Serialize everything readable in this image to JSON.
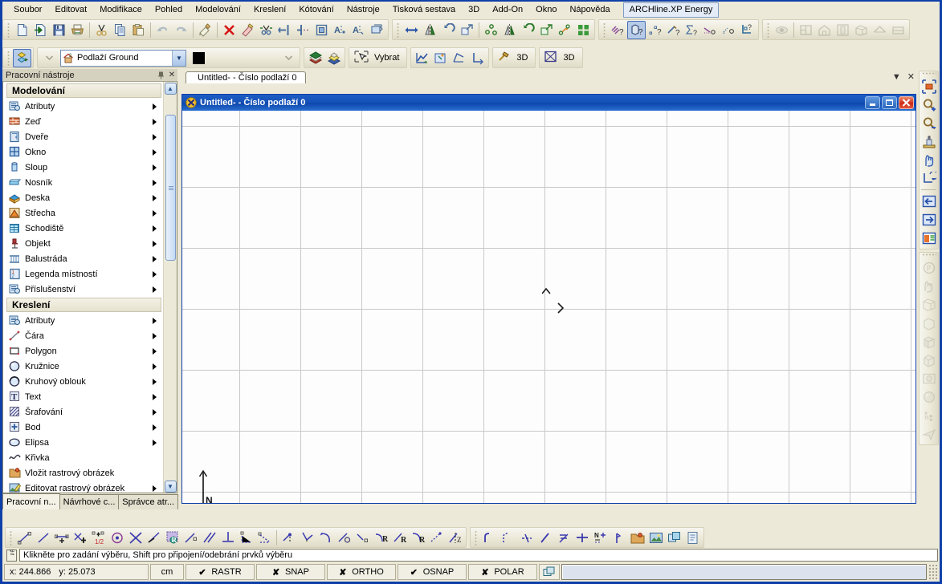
{
  "window": {
    "app_title": "ARCHline.XP Energy"
  },
  "menubar": {
    "items": [
      {
        "label": "Soubor",
        "name": "menu-soubor"
      },
      {
        "label": "Editovat",
        "name": "menu-editovat"
      },
      {
        "label": "Modifikace",
        "name": "menu-modifikace"
      },
      {
        "label": "Pohled",
        "name": "menu-pohled"
      },
      {
        "label": "Modelování",
        "name": "menu-modelovani"
      },
      {
        "label": "Kreslení",
        "name": "menu-kresleni"
      },
      {
        "label": "Kótování",
        "name": "menu-kotovani"
      },
      {
        "label": "Nástroje",
        "name": "menu-nastroje"
      },
      {
        "label": "Tisková sestava",
        "name": "menu-tiskova-sestava"
      },
      {
        "label": "3D",
        "name": "menu-3d"
      },
      {
        "label": "Add-On",
        "name": "menu-addon"
      },
      {
        "label": "Okno",
        "name": "menu-okno"
      },
      {
        "label": "Nápověda",
        "name": "menu-napoveda"
      }
    ],
    "addon_tab": "ARCHline.XP Energy"
  },
  "toolbar2": {
    "layer_value": "Podlaží Ground",
    "color_swatch": "#000000",
    "select_label": "Vybrat",
    "btn_3d_a_label": "3D",
    "btn_3d_b_label": "3D"
  },
  "left_panel": {
    "caption": "Pracovní nástroje",
    "sections": [
      {
        "title": "Modelování",
        "items": [
          {
            "label": "Atributy",
            "icon": "attributes-icon",
            "arrow": true
          },
          {
            "label": "Zeď",
            "icon": "wall-icon",
            "arrow": true
          },
          {
            "label": "Dveře",
            "icon": "door-icon",
            "arrow": true
          },
          {
            "label": "Okno",
            "icon": "window-icon",
            "arrow": true
          },
          {
            "label": "Sloup",
            "icon": "column-icon",
            "arrow": true
          },
          {
            "label": "Nosník",
            "icon": "beam-icon",
            "arrow": true
          },
          {
            "label": "Deska",
            "icon": "slab-icon",
            "arrow": true
          },
          {
            "label": "Střecha",
            "icon": "roof-icon",
            "arrow": true
          },
          {
            "label": "Schodiště",
            "icon": "stairs-icon",
            "arrow": true
          },
          {
            "label": "Objekt",
            "icon": "object-icon",
            "arrow": true
          },
          {
            "label": "Balustráda",
            "icon": "railing-icon",
            "arrow": true
          },
          {
            "label": "Legenda místností",
            "icon": "room-legend-icon",
            "arrow": true
          },
          {
            "label": "Příslušenství",
            "icon": "accessory-icon",
            "arrow": true
          }
        ]
      },
      {
        "title": "Kreslení",
        "items": [
          {
            "label": "Atributy",
            "icon": "attributes-icon",
            "arrow": true
          },
          {
            "label": "Čára",
            "icon": "line-icon",
            "arrow": true
          },
          {
            "label": "Polygon",
            "icon": "polygon-icon",
            "arrow": true
          },
          {
            "label": "Kružnice",
            "icon": "circle-icon",
            "arrow": true
          },
          {
            "label": "Kruhový oblouk",
            "icon": "arc-icon",
            "arrow": true
          },
          {
            "label": "Text",
            "icon": "text-icon",
            "arrow": true
          },
          {
            "label": "Šrafování",
            "icon": "hatch-icon",
            "arrow": true
          },
          {
            "label": "Bod",
            "icon": "point-icon",
            "arrow": true
          },
          {
            "label": "Elipsa",
            "icon": "ellipse-icon",
            "arrow": true
          },
          {
            "label": "Křivka",
            "icon": "spline-icon",
            "arrow": false
          },
          {
            "label": "Vložit rastrový obrázek",
            "icon": "insert-raster-icon",
            "arrow": false
          },
          {
            "label": "Editovat rastrový obrázek",
            "icon": "edit-raster-icon",
            "arrow": true
          }
        ]
      }
    ],
    "tabs": [
      {
        "label": "Pracovní n...",
        "active": true
      },
      {
        "label": "Návrhové c...",
        "active": false
      },
      {
        "label": "Správce atr...",
        "active": false
      }
    ]
  },
  "mdi": {
    "doc_tab": "Untitled- - Číslo podlaží 0",
    "child_title": "Untitled- - Číslo podlaží 0",
    "north_label": "N"
  },
  "prompt": {
    "text": "Klikněte pro zadání výběru, Shift pro připojení/odebrání prvků výběru"
  },
  "statusbar": {
    "coord_x": "x: 244.866",
    "coord_y": "y: 25.073",
    "unit": "cm",
    "toggles": [
      {
        "label": "RASTR",
        "mark": "✔",
        "on": true
      },
      {
        "label": "SNAP",
        "mark": "✘",
        "on": false
      },
      {
        "label": "ORTHO",
        "mark": "✘",
        "on": false
      },
      {
        "label": "OSNAP",
        "mark": "✔",
        "on": true
      },
      {
        "label": "POLAR",
        "mark": "✘",
        "on": false
      }
    ],
    "command_value": ""
  }
}
